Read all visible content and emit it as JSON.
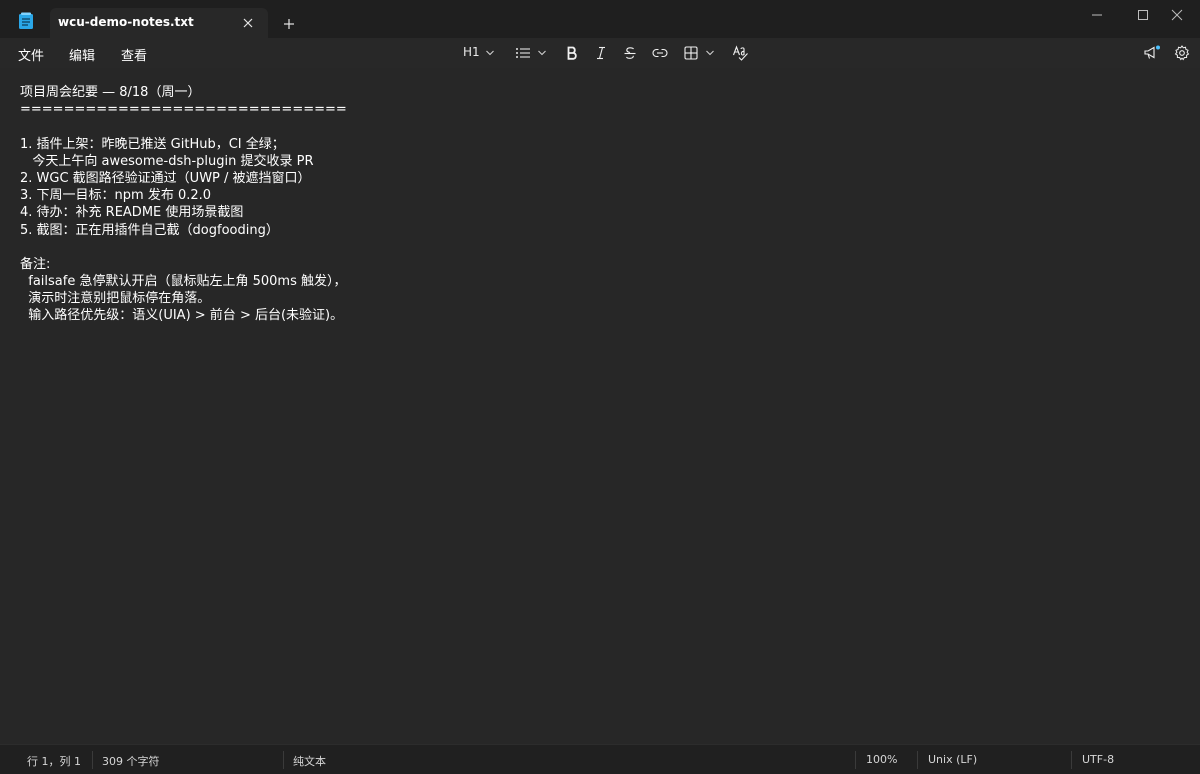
{
  "window": {
    "tab_title": "wcu-demo-notes.txt",
    "new_tab_symbol": "+"
  },
  "menu": {
    "file": "文件",
    "edit": "编辑",
    "view": "查看"
  },
  "toolbar": {
    "heading_label": "H1"
  },
  "document": {
    "lines": [
      "项目周会纪要 — 8/18（周一）",
      "==============================",
      "",
      "1. 插件上架：昨晚已推送 GitHub，CI 全绿；",
      "   今天上午向 awesome-dsh-plugin 提交收录 PR",
      "2. WGC 截图路径验证通过（UWP / 被遮挡窗口）",
      "3. 下周一目标：npm 发布 0.2.0",
      "4. 待办：补充 README 使用场景截图",
      "5. 截图：正在用插件自己截（dogfooding）",
      "",
      "备注:",
      "  failsafe 急停默认开启（鼠标贴左上角 500ms 触发），",
      "  演示时注意别把鼠标停在角落。",
      "  输入路径优先级：语义(UIA) > 前台 > 后台(未验证)。"
    ]
  },
  "status": {
    "position": "行 1，列 1",
    "char_count": "309 个字符",
    "format": "纯文本",
    "zoom": "100%",
    "line_ending": "Unix (LF)",
    "encoding": "UTF-8"
  },
  "colors": {
    "background": "#272727",
    "titlebar": "#1f1f1f",
    "accent": "#4cc2ff",
    "text": "#ffffff"
  }
}
